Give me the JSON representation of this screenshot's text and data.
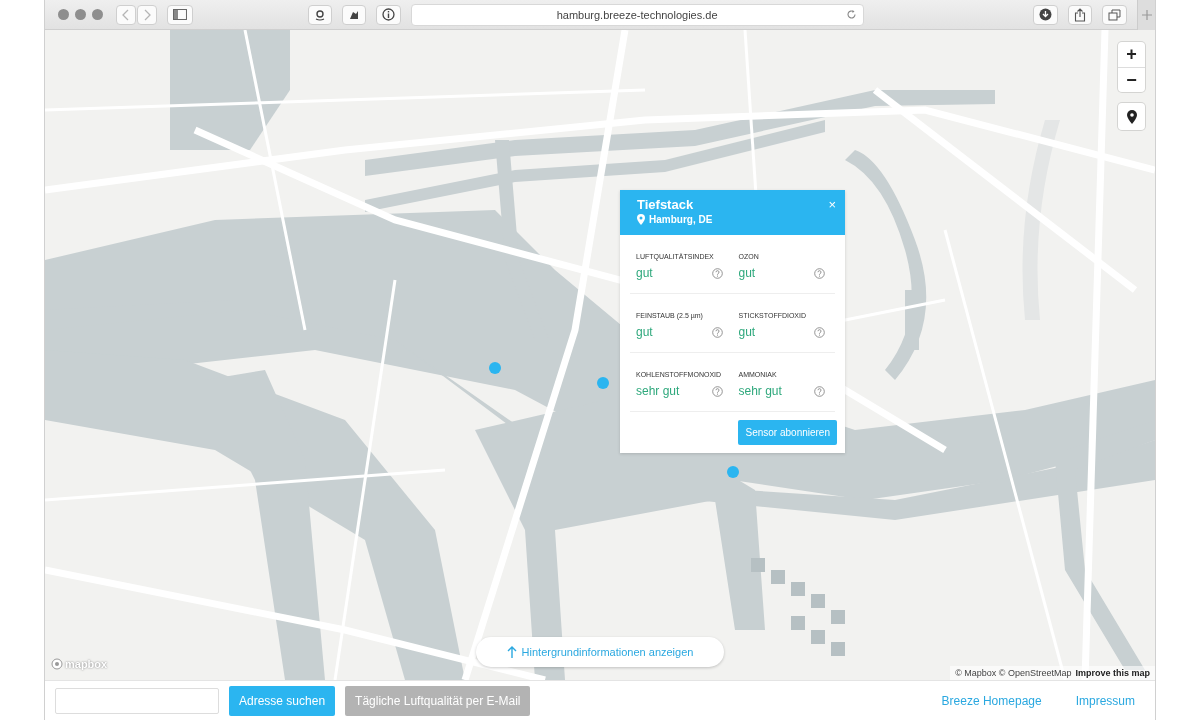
{
  "browser": {
    "url": "hamburg.breeze-technologies.de"
  },
  "map": {
    "zoom_in": "+",
    "zoom_out": "−",
    "logo": "mapbox",
    "attribution": "© Mapbox © OpenStreetMap",
    "improve_link": "Improve this map",
    "info_button": "Hintergrundinformationen anzeigen"
  },
  "popup": {
    "title": "Tiefstack",
    "location": "Hamburg, DE",
    "close": "×",
    "metrics": [
      {
        "label": "LUFTQUALITÄTSINDEX",
        "value": "gut"
      },
      {
        "label": "OZON",
        "value": "gut"
      },
      {
        "label": "FEINSTAUB (2.5 µm)",
        "value": "gut"
      },
      {
        "label": "STICKSTOFFDIOXID",
        "value": "gut"
      },
      {
        "label": "KOHLENSTOFFMONOXID",
        "value": "sehr gut"
      },
      {
        "label": "AMMONIAK",
        "value": "sehr gut"
      }
    ],
    "button": "Sensor abonnieren"
  },
  "bottom_bar": {
    "buttons": [
      {
        "label": "Adresse suchen",
        "kind": "primary"
      },
      {
        "label": "Tägliche Luftqualität per E-Mail",
        "kind": "secondary"
      }
    ],
    "links": [
      "Breeze Homepage",
      "Impressum"
    ]
  }
}
